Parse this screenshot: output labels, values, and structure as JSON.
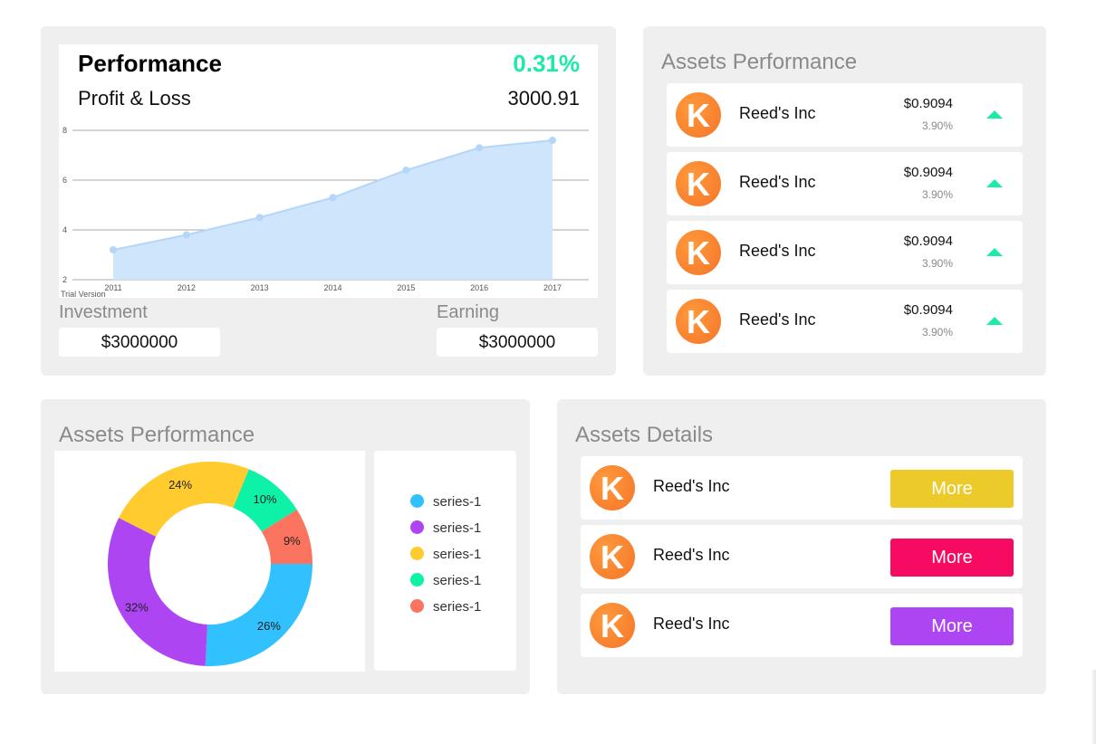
{
  "performance": {
    "title": "Performance",
    "percent": "0.31%",
    "pl_label": "Profit & Loss",
    "pl_value": "3000.91",
    "watermark": "Trial Version",
    "investment_label": "Investment",
    "investment_value": "$3000000",
    "earning_label": "Earning",
    "earning_value": "$3000000"
  },
  "chart_data": {
    "type": "area",
    "x": [
      "2011",
      "2012",
      "2013",
      "2014",
      "2015",
      "2016",
      "2017"
    ],
    "y_ticks": [
      2,
      4,
      6,
      8
    ],
    "ylim": [
      2,
      8
    ],
    "values": [
      3.2,
      3.8,
      4.5,
      5.3,
      6.4,
      7.3,
      7.6
    ],
    "grid": true
  },
  "assets_performance": {
    "title": "Assets Performance",
    "items": [
      {
        "logo": "K",
        "name": "Reed's Inc",
        "price": "$0.9094",
        "change": "3.90%"
      },
      {
        "logo": "K",
        "name": "Reed's Inc",
        "price": "$0.9094",
        "change": "3.90%"
      },
      {
        "logo": "K",
        "name": "Reed's Inc",
        "price": "$0.9094",
        "change": "3.90%"
      },
      {
        "logo": "K",
        "name": "Reed's Inc",
        "price": "$0.9094",
        "change": "3.90%"
      }
    ]
  },
  "assets_donut": {
    "title": "Assets Performance",
    "slices": [
      {
        "label": "26%",
        "value": 26,
        "color": "#31c1ff"
      },
      {
        "label": "32%",
        "value": 32,
        "color": "#ad45f2"
      },
      {
        "label": "24%",
        "value": 24,
        "color": "#ffcb2f"
      },
      {
        "label": "10%",
        "value": 10,
        "color": "#0df2a6"
      },
      {
        "label": "9%",
        "value": 9,
        "color": "#fa745f"
      }
    ],
    "legend": [
      {
        "name": "series-1",
        "color": "#31c1ff"
      },
      {
        "name": "series-1",
        "color": "#ad45f2"
      },
      {
        "name": "series-1",
        "color": "#ffcb2f"
      },
      {
        "name": "series-1",
        "color": "#0df2a6"
      },
      {
        "name": "series-1",
        "color": "#fa745f"
      }
    ]
  },
  "assets_details": {
    "title": "Assets Details",
    "items": [
      {
        "logo": "K",
        "name": "Reed's Inc",
        "button": "More",
        "color": "#ecca2a"
      },
      {
        "logo": "K",
        "name": "Reed's Inc",
        "button": "More",
        "color": "#f70a61"
      },
      {
        "logo": "K",
        "name": "Reed's Inc",
        "button": "More",
        "color": "#ad45f2"
      }
    ]
  },
  "colors": {
    "accent_green": "#1de9a8",
    "logo_orange": "#f47428",
    "card_bg": "#efefef"
  }
}
